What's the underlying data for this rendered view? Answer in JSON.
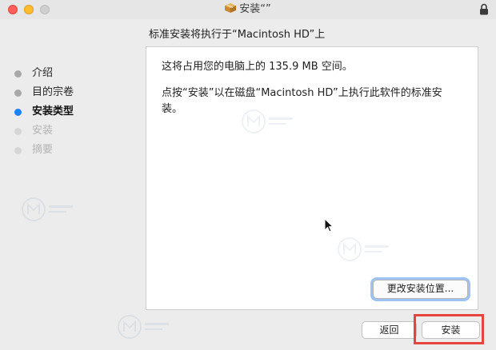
{
  "window": {
    "title": "安装“”"
  },
  "header": {
    "heading": "标准安装将执行于“Macintosh HD”上"
  },
  "sidebar": {
    "steps": [
      {
        "label": "介绍",
        "state": "done"
      },
      {
        "label": "目的宗卷",
        "state": "done"
      },
      {
        "label": "安装类型",
        "state": "current"
      },
      {
        "label": "安装",
        "state": "pending"
      },
      {
        "label": "摘要",
        "state": "pending"
      }
    ]
  },
  "content": {
    "space_text": "这将占用您的电脑上的 135.9 MB 空间。",
    "instruction_text": "点按“安装”以在磁盘“Macintosh HD”上执行此软件的标准安装。"
  },
  "buttons": {
    "change_location": "更改安装位置...",
    "back": "返回",
    "install": "安装"
  },
  "colors": {
    "current_step": "#1a82fb",
    "highlight": "#e8443e",
    "focus_ring": "#9dc3f3"
  },
  "icons": {
    "title": "package-icon",
    "lock": "lock-icon",
    "pointer": "mouse-cursor-icon"
  }
}
